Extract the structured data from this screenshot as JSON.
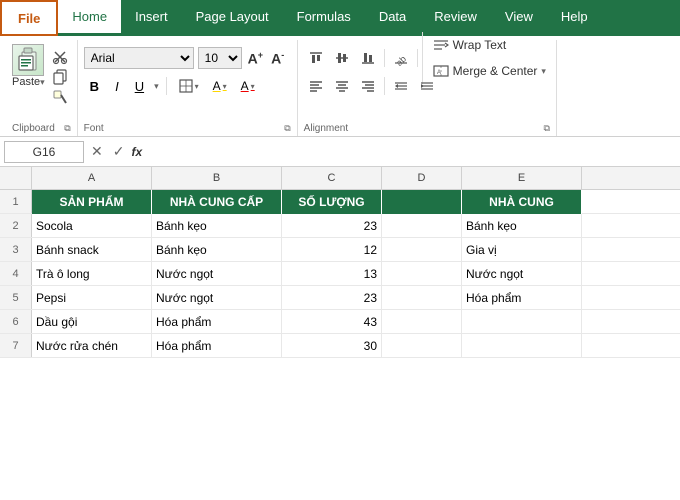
{
  "menubar": {
    "file": "File",
    "tabs": [
      "Home",
      "Insert",
      "Page Layout",
      "Formulas",
      "Data",
      "Review",
      "View",
      "Help"
    ]
  },
  "clipboard": {
    "paste_label": "Paste",
    "cut_icon": "✂",
    "copy_icon": "⧉",
    "format_painter_icon": "🖌",
    "section_label": "Clipboard"
  },
  "font": {
    "family": "Arial",
    "size": "10",
    "grow_icon": "A↑",
    "shrink_icon": "A↓",
    "bold": "B",
    "italic": "I",
    "underline": "U",
    "border_icon": "▦",
    "fill_icon": "A",
    "color_icon": "A",
    "section_label": "Font"
  },
  "alignment": {
    "section_label": "Alignment",
    "wrap_text": "Wrap Text",
    "merge_center": "Merge & Center",
    "icons": {
      "align_top": "⊤",
      "align_middle": "≡",
      "align_bottom": "⊥",
      "align_left": "≡",
      "align_center": "≡",
      "align_right": "≡",
      "indent_less": "◁",
      "indent_more": "▷",
      "orientation": "ab↕",
      "wrap": "↵",
      "merge": "⊞"
    }
  },
  "formula_bar": {
    "cell_ref": "G16",
    "fx": "fx",
    "value": ""
  },
  "columns": {
    "headers": [
      "A",
      "B",
      "C",
      "D",
      "E"
    ],
    "row_header": ""
  },
  "rows": [
    {
      "num": "1",
      "cells": [
        "SẢN PHẨM",
        "NHÀ CUNG CẤP",
        "SỐ LƯỢNG",
        "",
        "NHÀ CUNG"
      ],
      "is_header": true
    },
    {
      "num": "2",
      "cells": [
        "Socola",
        "Bánh kẹo",
        "23",
        "",
        "Bánh kẹo"
      ],
      "is_header": false
    },
    {
      "num": "3",
      "cells": [
        "Bánh snack",
        "Bánh kẹo",
        "12",
        "",
        "Gia vị"
      ],
      "is_header": false
    },
    {
      "num": "4",
      "cells": [
        "Trà ô long",
        "Nước ngọt",
        "13",
        "",
        "Nước ngọt"
      ],
      "is_header": false
    },
    {
      "num": "5",
      "cells": [
        "Pepsi",
        "Nước ngọt",
        "23",
        "",
        "Hóa phẩm"
      ],
      "is_header": false
    },
    {
      "num": "6",
      "cells": [
        "Dầu gội",
        "Hóa phẩm",
        "43",
        "",
        ""
      ],
      "is_header": false
    },
    {
      "num": "7",
      "cells": [
        "Nước rửa chén",
        "Hóa phẩm",
        "30",
        "",
        ""
      ],
      "is_header": false
    }
  ]
}
